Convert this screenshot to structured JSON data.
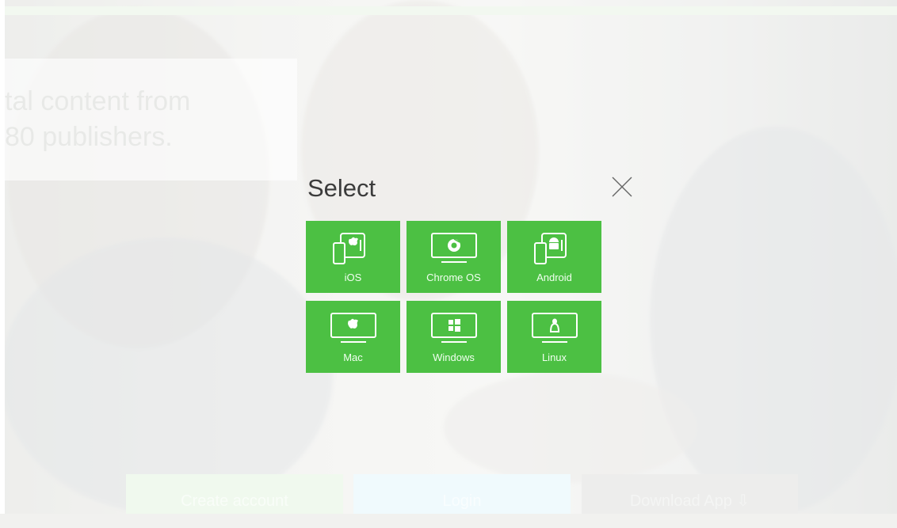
{
  "hero": {
    "line1": "tal content from",
    "line2": "80 publishers."
  },
  "modal": {
    "title": "Select",
    "close_icon": "close-icon",
    "options": [
      {
        "label": "iOS",
        "icon": "ios-device-icon"
      },
      {
        "label": "Chrome OS",
        "icon": "chrome-monitor-icon"
      },
      {
        "label": "Android",
        "icon": "android-device-icon"
      },
      {
        "label": "Mac",
        "icon": "apple-monitor-icon"
      },
      {
        "label": "Windows",
        "icon": "windows-monitor-icon"
      },
      {
        "label": "Linux",
        "icon": "linux-monitor-icon"
      }
    ]
  },
  "footer": {
    "create_label": "Create account",
    "login_label": "Login",
    "download_label": "Download App ⇩"
  },
  "colors": {
    "tile": "#4cc043",
    "title_text": "#3b3b3b"
  }
}
